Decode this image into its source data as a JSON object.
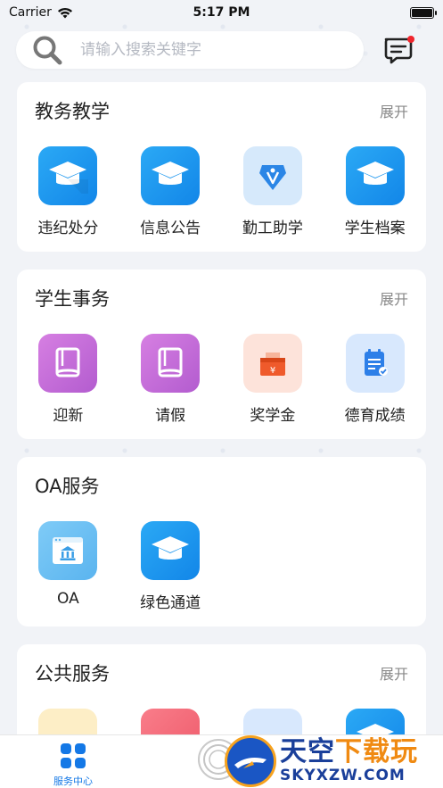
{
  "status": {
    "carrier": "Carrier",
    "time": "5:17 PM"
  },
  "search": {
    "placeholder": "请输入搜索关键字"
  },
  "sections": [
    {
      "title": "教务教学",
      "expand": "展开",
      "items": [
        {
          "label": "违纪处分",
          "icon": "graduation-cap-icon"
        },
        {
          "label": "信息公告",
          "icon": "graduation-cap-icon"
        },
        {
          "label": "勤工助学",
          "icon": "pen-nib-icon"
        },
        {
          "label": "学生档案",
          "icon": "graduation-cap-icon"
        }
      ]
    },
    {
      "title": "学生事务",
      "expand": "展开",
      "items": [
        {
          "label": "迎新",
          "icon": "book-icon"
        },
        {
          "label": "请假",
          "icon": "book-icon"
        },
        {
          "label": "奖学金",
          "icon": "money-box-icon"
        },
        {
          "label": "德育成绩",
          "icon": "checklist-icon"
        }
      ]
    },
    {
      "title": "OA服务",
      "items": [
        {
          "label": "OA",
          "icon": "building-window-icon"
        },
        {
          "label": "绿色通道",
          "icon": "graduation-cap-icon"
        }
      ]
    },
    {
      "title": "公共服务",
      "expand": "展开"
    }
  ],
  "tabbar": {
    "service_label": "服务中心"
  },
  "watermark": {
    "cn_main": "天空",
    "cn_accent": "下载玩",
    "en": "SKYXZW.COM"
  }
}
